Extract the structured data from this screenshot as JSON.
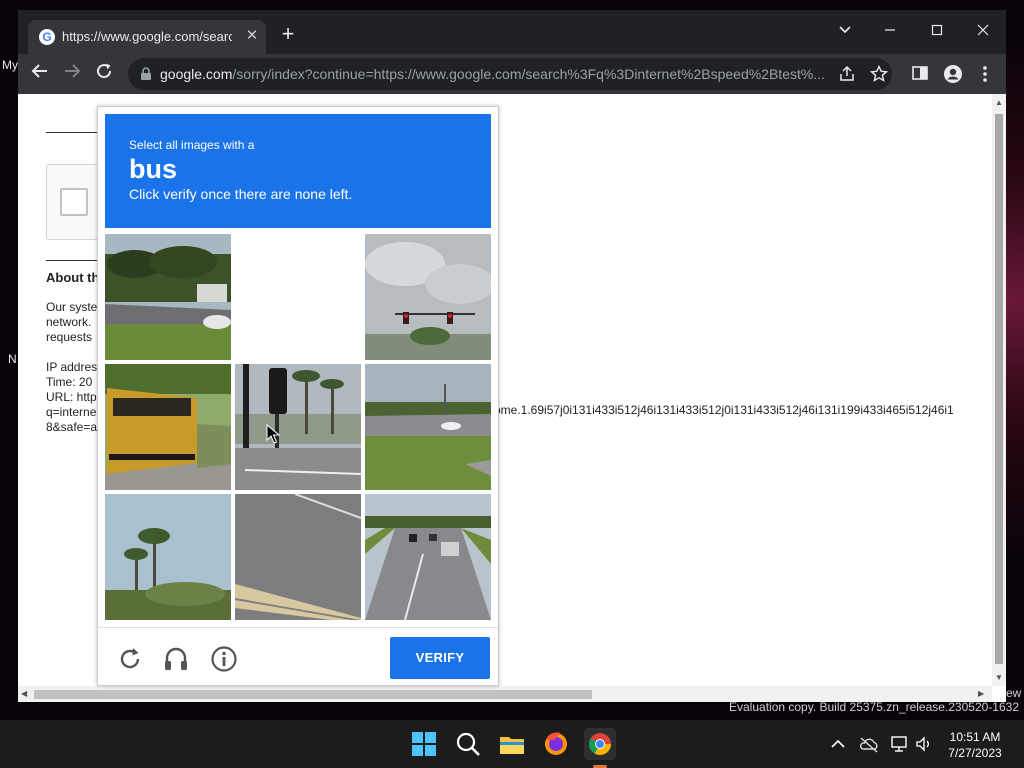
{
  "desktop": {
    "icon_label_1": "My",
    "icon_label_2": "N"
  },
  "browser": {
    "tab": {
      "title": "https://www.google.com/search?",
      "favicon": "G"
    },
    "address": {
      "host": "google.com",
      "path": "/sorry/index?continue=https://www.google.com/search%3Fq%3Dinternet%2Bspeed%2Btest%..."
    }
  },
  "page": {
    "about_heading": "About th",
    "line_1": "Our syste",
    "line_2": "network.",
    "line_3": "requests",
    "line_4": "IP addres",
    "line_5": "Time: 20",
    "line_6": "URL: http",
    "line_7": "q=interne",
    "line_8": "8&safe=a",
    "long_url_fragment": "ome.1.69i57j0i131i433i512j46i131i433i512j0i131i433i512j46i131i199i433i465i512j46i1"
  },
  "captcha": {
    "instruction_line1": "Select all images with a",
    "target_word": "bus",
    "instruction_line2": "Click verify once there are none left.",
    "tiles": [
      {
        "name": "tile-road-trees-car",
        "selected": false
      },
      {
        "name": "tile-blank",
        "selected": false
      },
      {
        "name": "tile-traffic-lights-sky",
        "selected": false
      },
      {
        "name": "tile-school-bus",
        "selected": false
      },
      {
        "name": "tile-traffic-light-palms",
        "selected": false
      },
      {
        "name": "tile-road-intersection",
        "selected": false
      },
      {
        "name": "tile-palm-trees",
        "selected": false
      },
      {
        "name": "tile-crosswalk",
        "selected": false
      },
      {
        "name": "tile-highway-cars",
        "selected": false
      }
    ],
    "verify_label": "VERIFY",
    "icons": [
      "reload-icon",
      "headphones-icon",
      "info-icon"
    ]
  },
  "watermark": {
    "text": "Evaluation copy. Build 25375.zn_release.230520-1632",
    "edge_text": "ew"
  },
  "taskbar": {
    "apps": [
      "windows-start-icon",
      "search-icon",
      "file-explorer-icon",
      "firefox-icon",
      "chrome-icon"
    ],
    "time": "10:51 AM",
    "date": "7/27/2023"
  },
  "colors": {
    "captcha_blue": "#1a73e8",
    "chrome_dark": "#202124",
    "toolbar": "#35363a"
  }
}
